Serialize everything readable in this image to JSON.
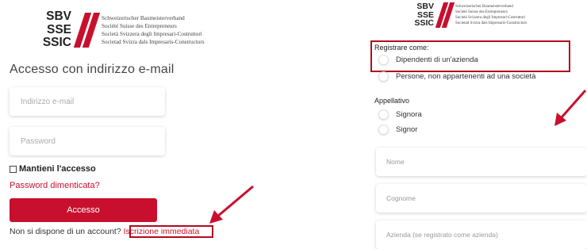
{
  "logo": {
    "abbr": [
      "SBV",
      "SSE",
      "SSIC"
    ],
    "names": [
      "Schweizerischer Baumeisterverband",
      "Société Suisse des Entrepreneurs",
      "Società Svizzera degli Impresari-Costruttori",
      "Societad Svizra dals Impresaris-Constructurs"
    ]
  },
  "login": {
    "title": "Accesso con indirizzo e-mail",
    "email_placeholder": "Indirizzo e-mail",
    "password_placeholder": "Password",
    "remember_label": "Mantieni l'accesso",
    "forgot_link": "Password dimenticata?",
    "login_button": "Accesso",
    "no_account_text": "Non si dispone di un account?",
    "register_link": "Iscrizione immediata"
  },
  "registration": {
    "register_as_label": "Registrare come:",
    "register_options": [
      "Dipendenti di un'azienda",
      "Persone, non appartenenti ad una società"
    ],
    "salutation_label": "Appellativo",
    "salutation_options": [
      "Signora",
      "Signor"
    ],
    "first_name_placeholder": "Nome",
    "last_name_placeholder": "Cognome",
    "company_placeholder": "Azienda (se registrato come azienda)"
  },
  "colors": {
    "accent": "#c8102e",
    "highlight": "#b00c1c"
  }
}
